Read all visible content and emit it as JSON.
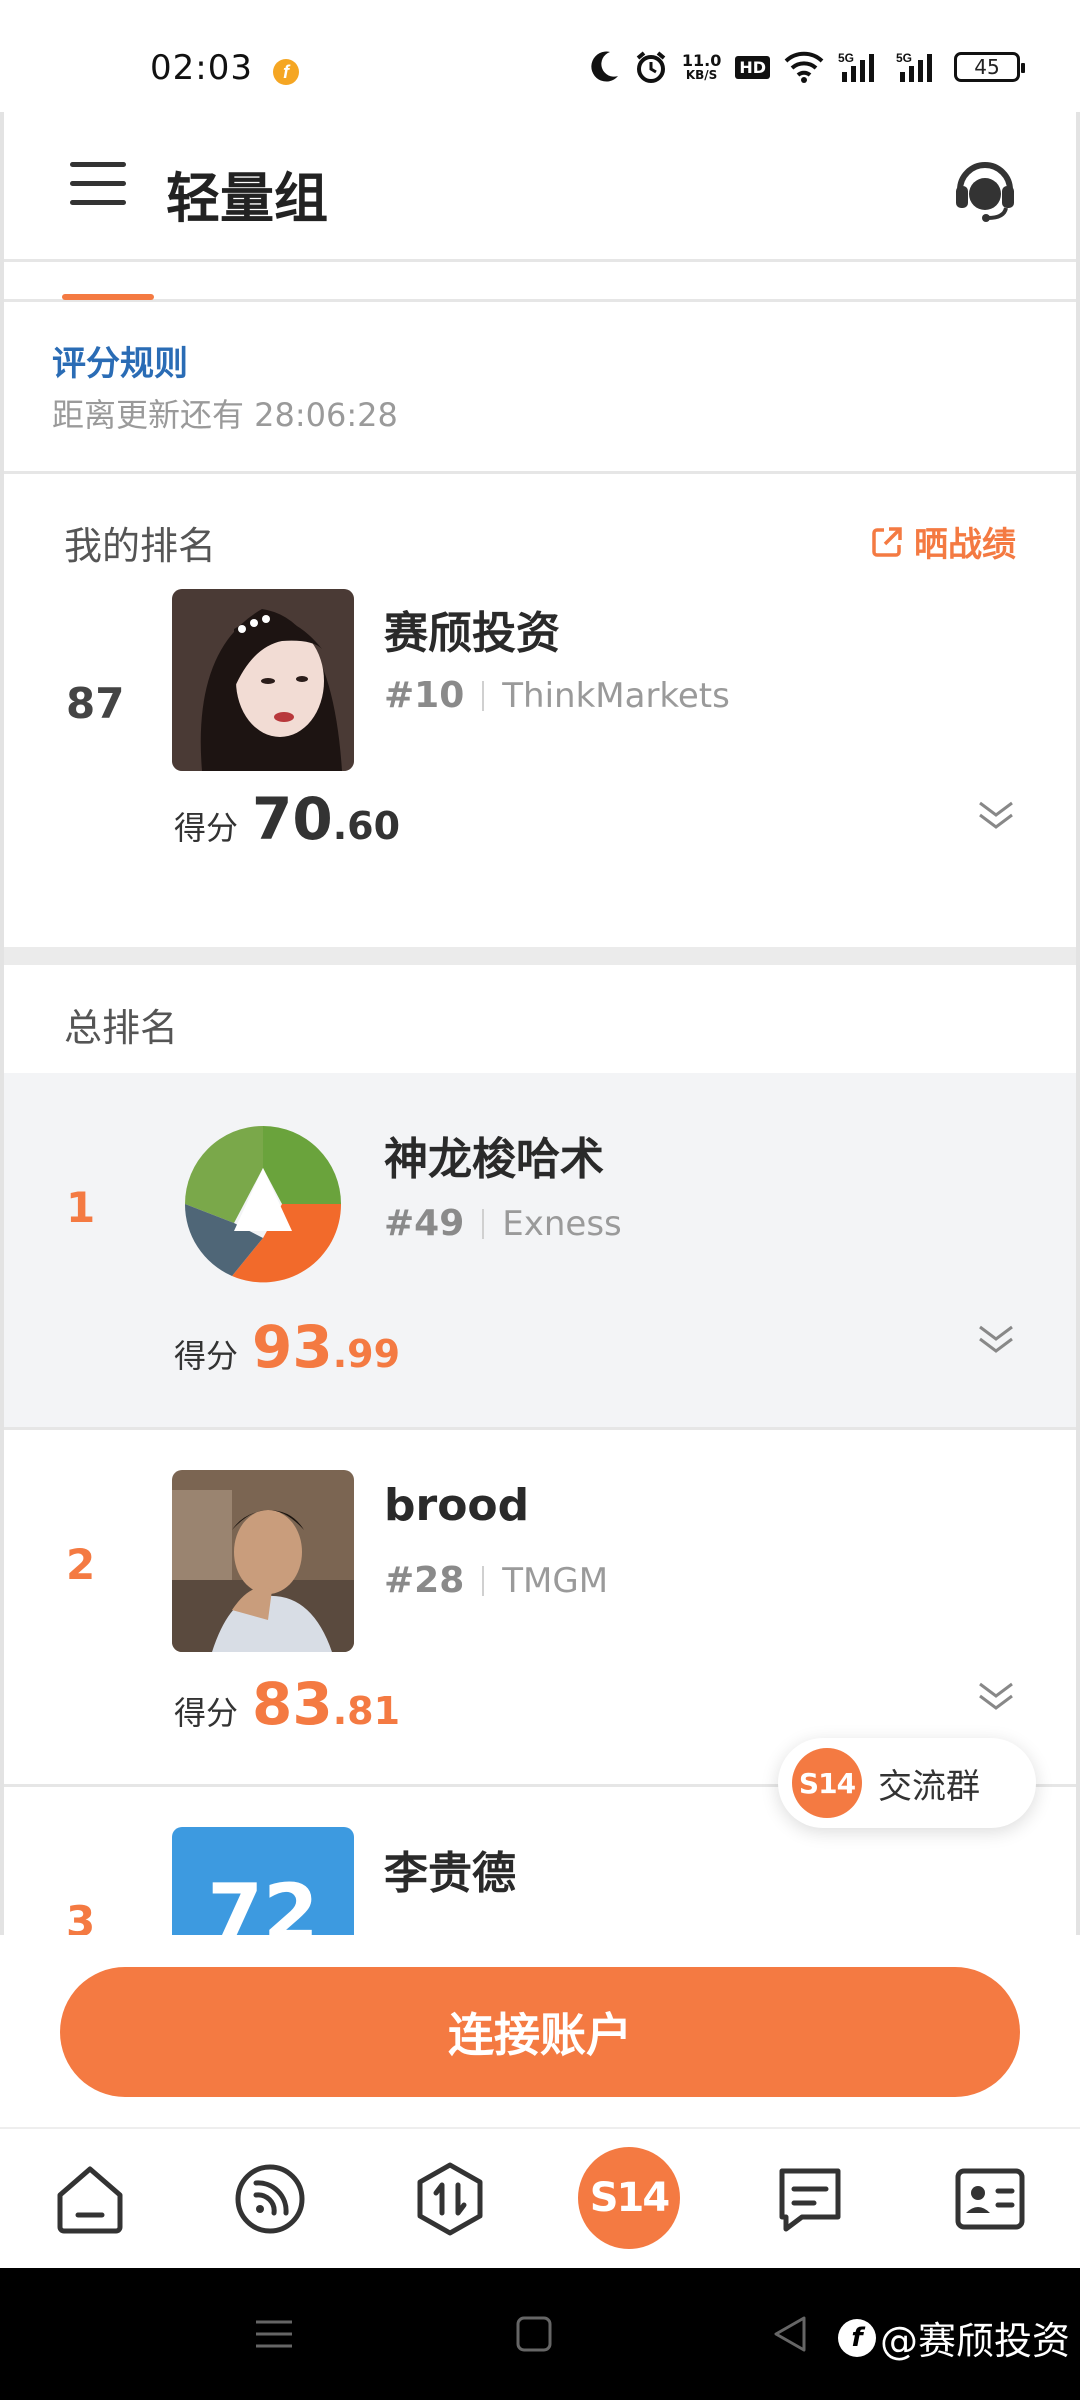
{
  "status_bar": {
    "time": "02:03",
    "speed_value": "11.0",
    "speed_unit": "KB/S",
    "hd": "HD",
    "battery": "45"
  },
  "header": {
    "title": "轻量组"
  },
  "rules": {
    "link": "评分规则",
    "countdown": "距离更新还有 28:06:28"
  },
  "my_rank": {
    "section_title": "我的排名",
    "share_label": "晒战绩",
    "rank": "87",
    "name": "赛颀投资",
    "id": "#10",
    "broker": "ThinkMarkets",
    "score_label": "得分",
    "score_int": "70",
    "score_dec": ".60"
  },
  "total_rank": {
    "section_title": "总排名",
    "entries": [
      {
        "rank": "1",
        "name": "神龙梭哈术",
        "id": "#49",
        "broker": "Exness",
        "score_label": "得分",
        "score_int": "93",
        "score_dec": ".99"
      },
      {
        "rank": "2",
        "name": "brood",
        "id": "#28",
        "broker": "TMGM",
        "score_label": "得分",
        "score_int": "83",
        "score_dec": ".81"
      },
      {
        "rank": "3",
        "name": "李贵德",
        "avatar_text": "72"
      }
    ]
  },
  "float_group": {
    "badge": "S14",
    "label": "交流群"
  },
  "cta": {
    "connect_label": "连接账户"
  },
  "tabbar": {
    "center_badge": "S14"
  },
  "watermark": {
    "text": "@赛颀投资"
  },
  "colors": {
    "accent": "#f47a42",
    "link": "#2a6cb5",
    "highlight_row": "#f3f4f6"
  }
}
